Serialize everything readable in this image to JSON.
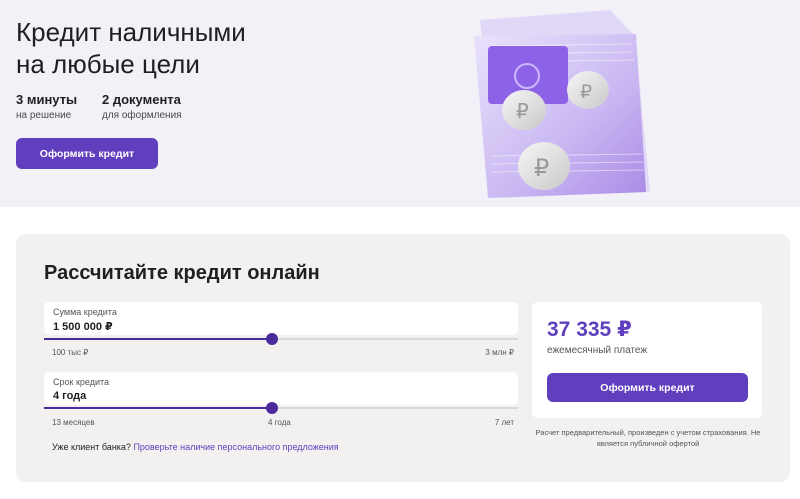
{
  "hero": {
    "title_line1": "Кредит наличными",
    "title_line2": "на любые цели",
    "facts": [
      {
        "value": "3 минуты",
        "sub": "на решение"
      },
      {
        "value": "2 документа",
        "sub": "для оформления"
      }
    ],
    "button_label": "Оформить кредит"
  },
  "calculator": {
    "title": "Рассчитайте кредит онлайн",
    "amount": {
      "label": "Сумма кредита",
      "value": "1 500 000 ₽",
      "min_label": "100 тыс ₽",
      "max_label": "3 млн ₽",
      "slider_fraction": 0.48
    },
    "term": {
      "label": "Срок кредита",
      "value": "4 года",
      "min_label": "13 месяцев",
      "mid_label": "4 года",
      "max_label": "7 лет",
      "slider_fraction": 0.48
    },
    "client_text": "Уже клиент банка?",
    "client_link": "Проверьте наличие персонального предложения"
  },
  "result": {
    "payment": "37 335 ₽",
    "payment_label": "ежемесячный платеж",
    "button_label": "Оформить кредит",
    "disclaimer": "Расчет предварительный, произведен с учетом страхования. Не является публичной офертой"
  },
  "colors": {
    "accent": "#5f3fbd",
    "slider": "#4b2a9b",
    "hero_bg": "#f3f1f8",
    "calc_bg": "#f2f1f0"
  }
}
